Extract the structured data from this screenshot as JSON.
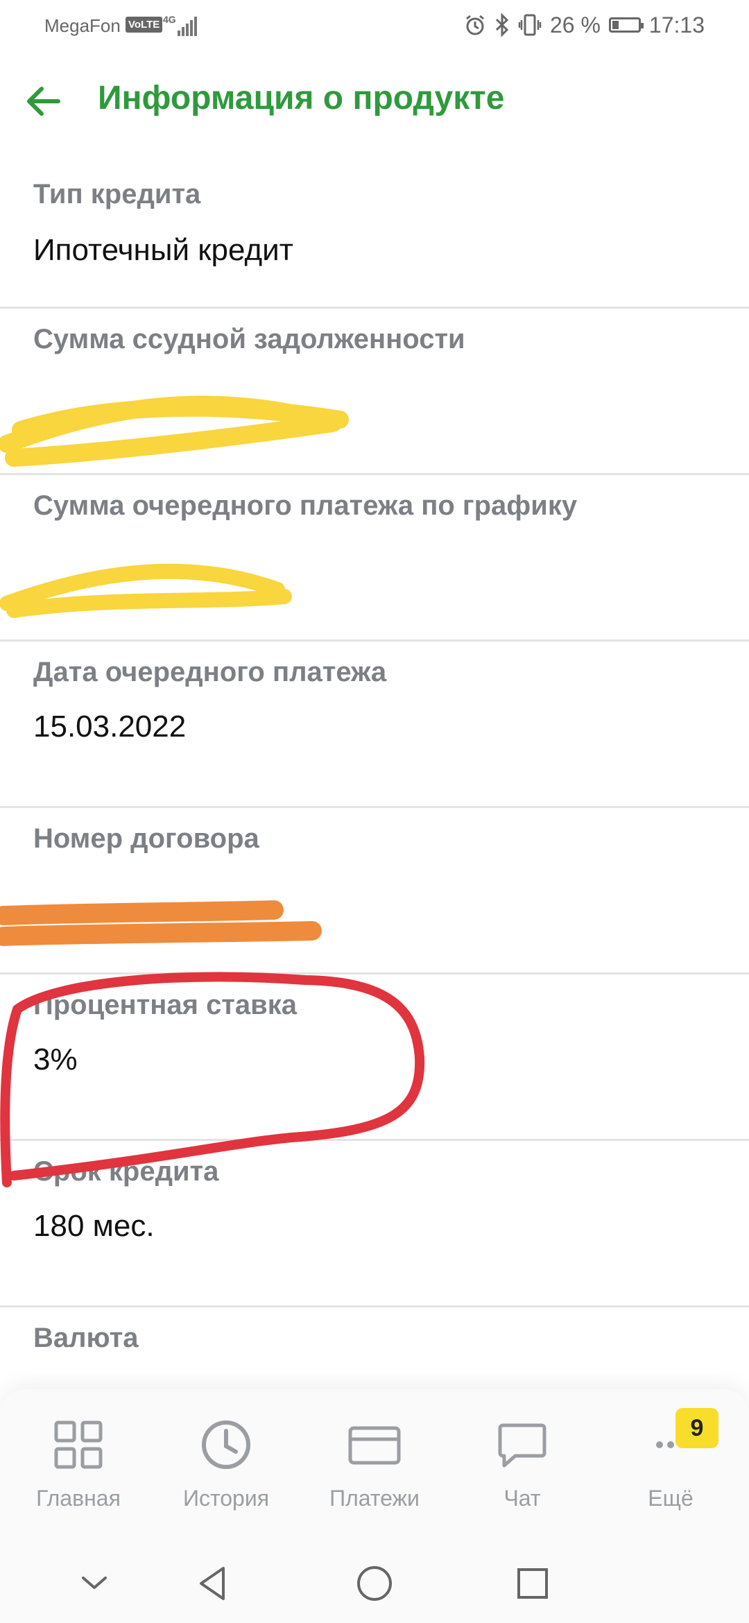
{
  "status_bar": {
    "carrier": "MegaFon",
    "volte": "VoLTE",
    "network": "4G",
    "battery": "26 %",
    "battery_level": 0.26,
    "time": "17:13"
  },
  "header": {
    "title": "Информация о продукте"
  },
  "fields": [
    {
      "label": "Тип кредита",
      "value": "Ипотечный кредит"
    },
    {
      "label": "Сумма ссудной задолженности",
      "value": ""
    },
    {
      "label": "Сумма очередного платежа по графику",
      "value": ""
    },
    {
      "label": "Дата очередного платежа",
      "value": "15.03.2022"
    },
    {
      "label": "Номер договора",
      "value": ""
    },
    {
      "label": "Процентная ставка",
      "value": "3%"
    },
    {
      "label": "Срок кредита",
      "value": "180 мес."
    },
    {
      "label": "Валюта",
      "value": ""
    }
  ],
  "bottom_nav": {
    "items": [
      {
        "label": "Главная",
        "icon": "grid-icon"
      },
      {
        "label": "История",
        "icon": "clock-icon"
      },
      {
        "label": "Платежи",
        "icon": "card-icon"
      },
      {
        "label": "Чат",
        "icon": "chat-bubble-icon"
      },
      {
        "label": "Ещё",
        "icon": "more-dots-icon"
      }
    ],
    "more_badge": "9"
  },
  "colors": {
    "accent": "#2f9a3c",
    "label": "#7c8085",
    "badge": "#f8dd2b",
    "highlight_circle": "#e0343f",
    "redaction_yellow": "#f9d53e",
    "redaction_orange": "#ef8b3c"
  }
}
